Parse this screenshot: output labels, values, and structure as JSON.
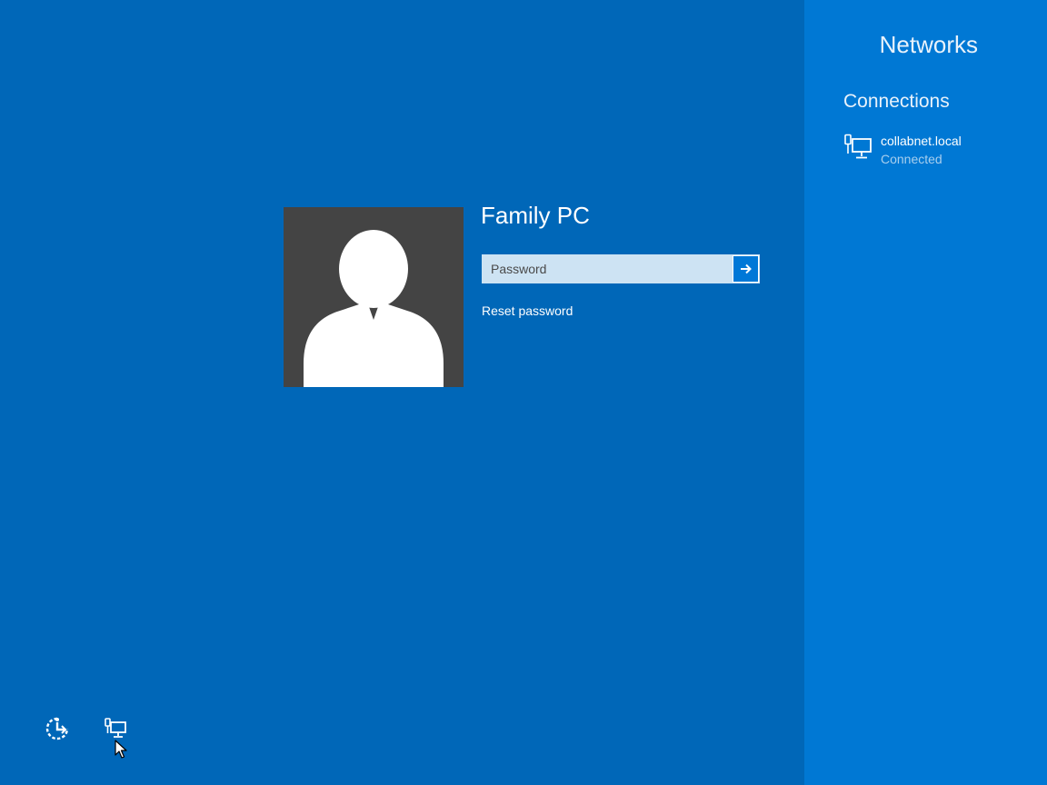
{
  "login": {
    "user_name": "Family PC",
    "password_placeholder": "Password",
    "reset_password_label": "Reset password"
  },
  "networks_panel": {
    "title": "Networks",
    "connections_heading": "Connections",
    "connections": [
      {
        "name": "collabnet.local",
        "status": "Connected",
        "icon": "wired-network-icon"
      }
    ]
  },
  "bottom_bar": {
    "icons": [
      "ease-of-access-icon",
      "network-icon"
    ]
  },
  "colors": {
    "background": "#0067b8",
    "panel": "#0078d4",
    "avatar_bg": "#444444",
    "input_bg": "#cde3f3",
    "submit_button": "#0078d7"
  }
}
